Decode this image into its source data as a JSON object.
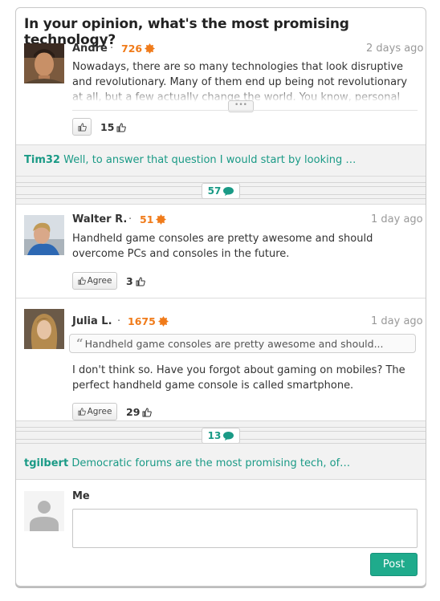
{
  "question_title": "In your opinion, what's the most promising technology?",
  "posts": [
    {
      "user": "André",
      "score": "726",
      "time": "2 days ago",
      "text": "Nowadays, there are so many technologies that look disruptive and revolutionary. Many of them end up being not revolutionary at all, but a few actually change the world. You know, personal computers, smartphones and the internet.",
      "likes": "15"
    },
    {
      "user": "Walter R.",
      "score": "51",
      "time": "1 day ago",
      "text": "Handheld game consoles are pretty awesome and should overcome PCs and consoles in the future.",
      "agree_label": "Agree",
      "likes": "3"
    },
    {
      "user": "Julia L.",
      "score": "1675",
      "time": "1 day ago",
      "quote": "Handheld game consoles are pretty awesome and should...",
      "text": "I don't think so. Have you forgot about gaming on mobiles? The perfect handheld game console is called smartphone.",
      "agree_label": "Agree",
      "likes": "29"
    }
  ],
  "collapsed_top": {
    "user": "Tim32",
    "text": "Well, to answer that question I would start by looking …"
  },
  "collapsed_bottom": {
    "user": "tgilbert",
    "text": "Democratic forums are the most promising tech, of…"
  },
  "hidden_counts": [
    "57",
    "13"
  ],
  "reply": {
    "user": "Me",
    "value": "",
    "post_label": "Post"
  },
  "colors": {
    "accent": "#1a9a86",
    "score": "#f07b1a",
    "button": "#1fab8c"
  }
}
